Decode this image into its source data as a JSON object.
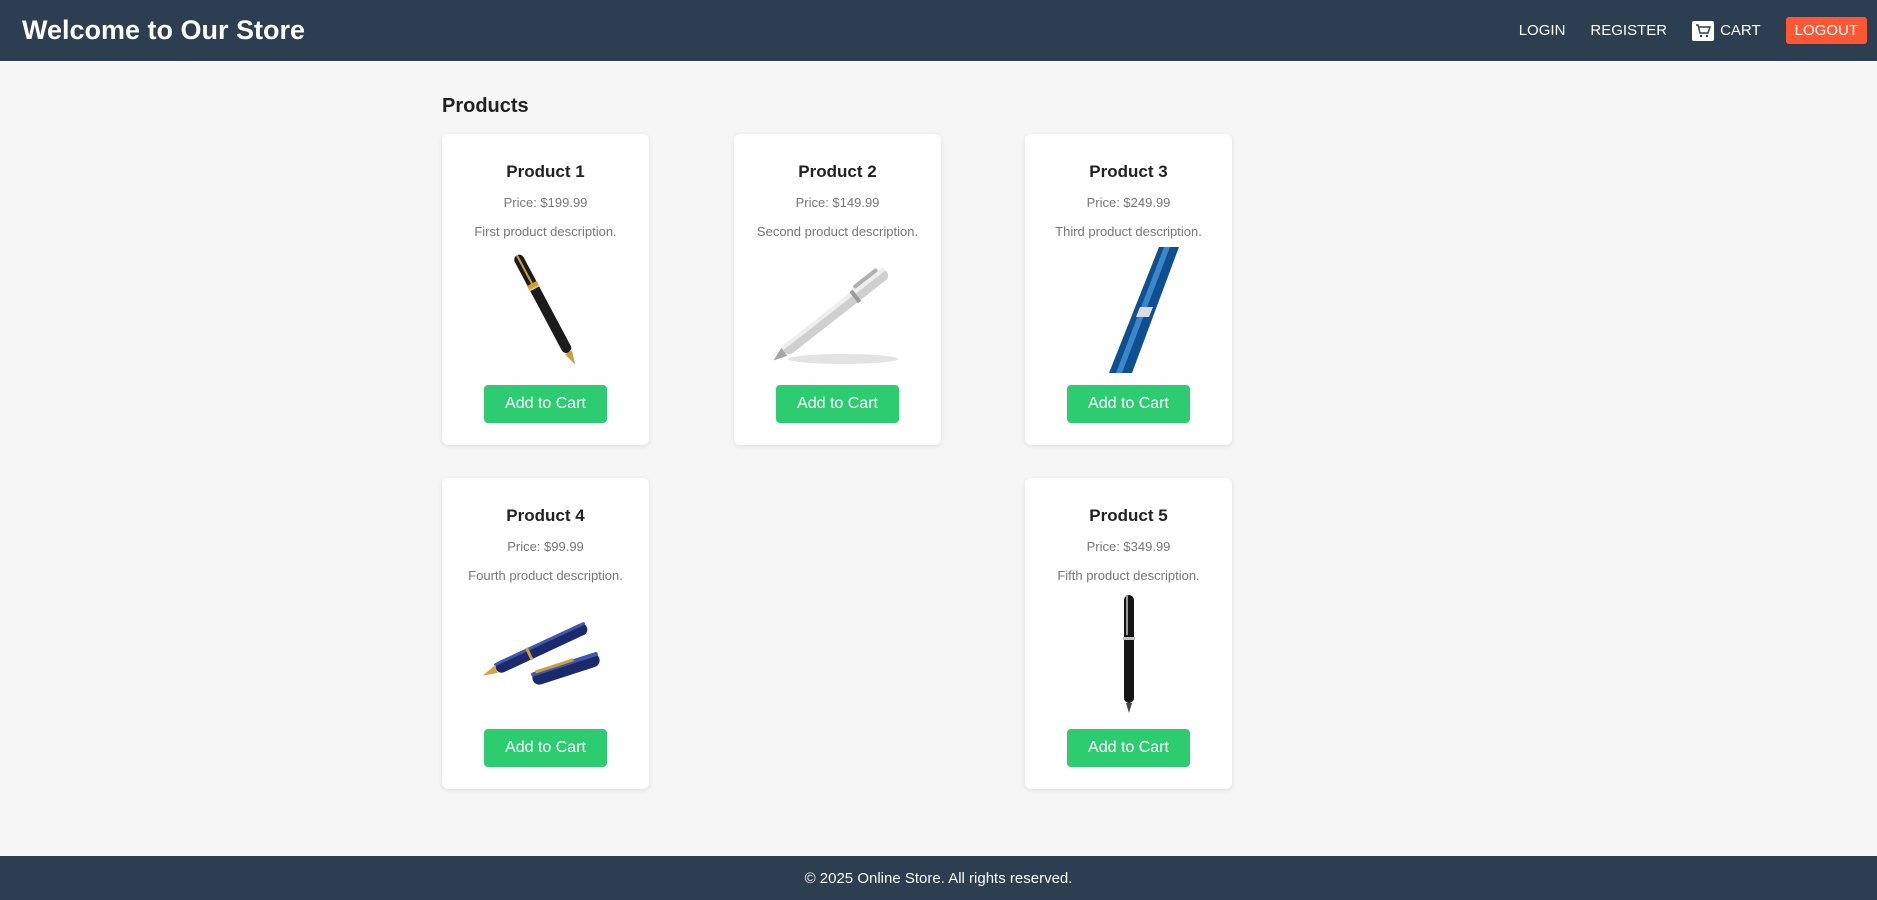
{
  "header": {
    "title": "Welcome to Our Store",
    "nav": {
      "login": "LOGIN",
      "register": "REGISTER",
      "cart": "CART",
      "logout": "LOGOUT"
    }
  },
  "main": {
    "heading": "Products",
    "products": [
      {
        "name": "Product 1",
        "price": "Price: $199.99",
        "description": "First product description.",
        "button": "Add to Cart",
        "image": "black-gold-fountain-pen"
      },
      {
        "name": "Product 2",
        "price": "Price: $149.99",
        "description": "Second product description.",
        "button": "Add to Cart",
        "image": "silver-ballpoint-pen"
      },
      {
        "name": "Product 3",
        "price": "Price: $249.99",
        "description": "Third product description.",
        "button": "Add to Cart",
        "image": "blue-pen-closeup"
      },
      {
        "name": "Product 4",
        "price": "Price: $99.99",
        "description": "Fourth product description.",
        "button": "Add to Cart",
        "image": "blue-fountain-pen-with-cap"
      },
      {
        "name": "Product 5",
        "price": "Price: $349.99",
        "description": "Fifth product description.",
        "button": "Add to Cart",
        "image": "black-rollerball-pen"
      }
    ]
  },
  "footer": {
    "text": "© 2025 Online Store. All rights reserved."
  },
  "colors": {
    "header_bg": "#2c3e50",
    "page_bg": "#f6f6f6",
    "logout_bg": "#ff5733",
    "add_to_cart_bg": "#2ecc71"
  }
}
